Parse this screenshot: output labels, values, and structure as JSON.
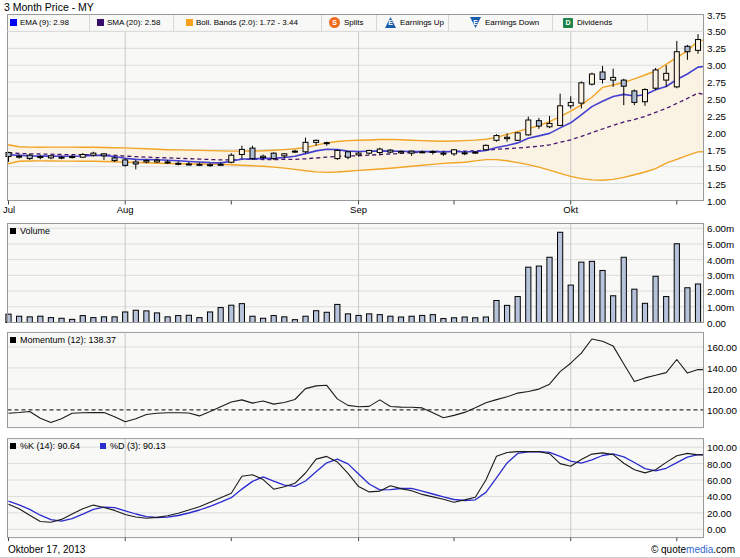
{
  "title": "3 Month Price - MY",
  "price_legend": {
    "ema": {
      "label": "EMA (9): 2.98",
      "swatch": "#0202f0"
    },
    "sma": {
      "label": "SMA (20): 2.58",
      "swatch": "#3a0d68"
    },
    "boll": {
      "label": "Boll. Bands (2.0): 1.72 - 3.44",
      "swatch": "#f6a21d"
    },
    "splits": {
      "label": "Splits",
      "badge": "S",
      "badge_color": "#f26a1b"
    },
    "earnings_up": {
      "label": "Earnings Up",
      "badge": "E",
      "badge_color": "#1a5dab"
    },
    "earnings_down": {
      "label": "Earnings Down",
      "badge": "E",
      "badge_color": "#1a5dab"
    },
    "dividends": {
      "label": "Dividends",
      "badge": "D",
      "badge_color": "#1d8348"
    }
  },
  "panel_labels": {
    "volume": "Volume",
    "momentum": "Momentum (12): 138.37",
    "k": "%K (14): 90.64",
    "d": "%D (3): 90.13"
  },
  "footer": {
    "date": "Oktober 17, 2013",
    "copyright_prefix": "© quote",
    "copyright_brand": "media",
    "copyright_suffix": ".com"
  },
  "colors": {
    "ema_line": "#4340d2",
    "sma_line": "#48156e",
    "boll_line": "#f2a424",
    "boll_fill": "#faf2e2",
    "candle_down_fill": "#aebcd4",
    "candle_stroke": "#000000",
    "volume_fill": "#b7c3da",
    "volume_stroke": "#000000",
    "momentum_line": "#1c1c1c",
    "k_line": "#1c1c1c",
    "d_line": "#2b2bd0",
    "grid": "#dcdcdc",
    "month_line": "#c9c9c9",
    "panel_border": "#9a9a9a",
    "panel_bg": "#f8f8f6",
    "brand_blue": "#3366cc"
  },
  "chart_data": [
    {
      "name": "price",
      "type": "candlestick",
      "title": "3 Month Price - MY",
      "ylim": [
        1.0,
        3.75
      ],
      "yticks": [
        "3.75",
        "3.50",
        "3.25",
        "3.00",
        "2.75",
        "2.50",
        "2.25",
        "2.00",
        "1.75",
        "1.50",
        "1.25",
        "1.00"
      ],
      "x_months": [
        {
          "label": "Jul",
          "i": 0
        },
        {
          "label": "Aug",
          "i": 11
        },
        {
          "label": "Sep",
          "i": 33
        },
        {
          "label": "Okt",
          "i": 53
        }
      ],
      "x_midticks": [
        21,
        42,
        63
      ],
      "open": [
        1.71,
        1.655,
        1.67,
        1.65,
        1.63,
        1.64,
        1.65,
        1.64,
        1.67,
        1.69,
        1.63,
        1.6,
        1.57,
        1.57,
        1.57,
        1.57,
        1.55,
        1.54,
        1.535,
        1.53,
        1.535,
        1.565,
        1.68,
        1.775,
        1.635,
        1.7,
        1.66,
        1.73,
        1.72,
        1.86,
        1.855,
        1.62,
        1.72,
        1.675,
        1.7,
        1.71,
        1.745,
        1.705,
        1.73,
        1.72,
        1.725,
        1.7,
        1.69,
        1.7,
        1.705,
        1.75,
        1.89,
        1.915,
        1.89,
        1.97,
        2.18,
        2.09,
        2.11,
        2.4,
        2.44,
        2.72,
        2.9,
        2.78,
        2.78,
        2.62,
        2.46,
        2.66,
        2.78,
        2.68,
        3.28,
        3.22
      ],
      "high": [
        1.72,
        1.68,
        1.69,
        1.67,
        1.67,
        1.66,
        1.67,
        1.7,
        1.72,
        1.7,
        1.65,
        1.62,
        1.6,
        1.61,
        1.62,
        1.6,
        1.58,
        1.57,
        1.56,
        1.55,
        1.56,
        1.7,
        1.81,
        1.81,
        1.68,
        1.71,
        1.7,
        1.75,
        1.93,
        1.9,
        1.87,
        1.75,
        1.73,
        1.72,
        1.75,
        1.78,
        1.76,
        1.74,
        1.74,
        1.74,
        1.74,
        1.73,
        1.76,
        1.73,
        1.73,
        1.83,
        1.98,
        1.99,
        2.01,
        2.24,
        2.22,
        2.25,
        2.58,
        2.54,
        2.76,
        2.89,
        2.99,
        2.95,
        2.8,
        2.64,
        2.66,
        2.96,
        3.0,
        3.36,
        3.3,
        3.46
      ],
      "low": [
        1.57,
        1.62,
        1.6,
        1.61,
        1.61,
        1.61,
        1.62,
        1.63,
        1.65,
        1.6,
        1.57,
        1.5,
        1.46,
        1.55,
        1.555,
        1.54,
        1.52,
        1.52,
        1.51,
        1.5,
        1.51,
        1.55,
        1.62,
        1.6,
        1.61,
        1.6,
        1.62,
        1.7,
        1.7,
        1.81,
        1.81,
        1.6,
        1.61,
        1.65,
        1.68,
        1.67,
        1.7,
        1.69,
        1.66,
        1.7,
        1.68,
        1.66,
        1.66,
        1.67,
        1.69,
        1.74,
        1.87,
        1.87,
        1.88,
        1.96,
        2.06,
        2.07,
        2.1,
        2.36,
        2.36,
        2.7,
        2.73,
        2.68,
        2.41,
        2.41,
        2.4,
        2.63,
        2.68,
        2.66,
        3.08,
        3.17
      ],
      "close": [
        1.65,
        1.655,
        1.62,
        1.64,
        1.66,
        1.64,
        1.65,
        1.68,
        1.7,
        1.66,
        1.59,
        1.52,
        1.54,
        1.59,
        1.595,
        1.57,
        1.55,
        1.54,
        1.535,
        1.53,
        1.535,
        1.67,
        1.755,
        1.62,
        1.655,
        1.62,
        1.69,
        1.72,
        1.86,
        1.89,
        1.85,
        1.74,
        1.64,
        1.7,
        1.74,
        1.76,
        1.715,
        1.725,
        1.7,
        1.72,
        1.725,
        1.7,
        1.75,
        1.705,
        1.715,
        1.815,
        1.96,
        1.935,
        2.0,
        2.19,
        2.1,
        2.14,
        2.4,
        2.45,
        2.74,
        2.87,
        2.79,
        2.82,
        2.69,
        2.45,
        2.64,
        2.93,
        2.88,
        3.2,
        3.2,
        3.38
      ],
      "series": [
        {
          "name": "EMA (9)",
          "values": [
            1.674,
            1.67,
            1.66,
            1.656,
            1.657,
            1.654,
            1.653,
            1.658,
            1.667,
            1.665,
            1.65,
            1.624,
            1.607,
            1.604,
            1.602,
            1.596,
            1.587,
            1.577,
            1.569,
            1.561,
            1.556,
            1.579,
            1.614,
            1.615,
            1.623,
            1.622,
            1.636,
            1.653,
            1.694,
            1.733,
            1.757,
            1.753,
            1.731,
            1.725,
            1.728,
            1.734,
            1.73,
            1.729,
            1.723,
            1.723,
            1.723,
            1.719,
            1.725,
            1.721,
            1.72,
            1.739,
            1.783,
            1.813,
            1.851,
            1.919,
            1.955,
            1.992,
            2.074,
            2.149,
            2.267,
            2.388,
            2.468,
            2.538,
            2.569,
            2.545,
            2.564,
            2.637,
            2.686,
            2.789,
            2.871,
            2.973
          ]
        },
        {
          "name": "SMA (20)",
          "values": [
            1.702,
            1.697,
            1.691,
            1.687,
            1.684,
            1.68,
            1.678,
            1.677,
            1.676,
            1.673,
            1.668,
            1.657,
            1.647,
            1.641,
            1.635,
            1.63,
            1.624,
            1.618,
            1.612,
            1.606,
            1.6,
            1.601,
            1.607,
            1.607,
            1.606,
            1.605,
            1.607,
            1.609,
            1.617,
            1.629,
            1.642,
            1.653,
            1.658,
            1.663,
            1.67,
            1.68,
            1.688,
            1.698,
            1.706,
            1.715,
            1.725,
            1.726,
            1.726,
            1.73,
            1.733,
            1.743,
            1.757,
            1.767,
            1.774,
            1.789,
            1.802,
            1.822,
            1.86,
            1.897,
            1.947,
            2.003,
            2.057,
            2.111,
            2.161,
            2.197,
            2.243,
            2.304,
            2.361,
            2.436,
            2.51,
            2.588
          ]
        },
        {
          "name": "Boll. Bands upper",
          "values": [
            1.825,
            1.795,
            1.79,
            1.788,
            1.789,
            1.79,
            1.789,
            1.787,
            1.786,
            1.783,
            1.78,
            1.777,
            1.771,
            1.764,
            1.757,
            1.751,
            1.748,
            1.745,
            1.741,
            1.738,
            1.734,
            1.731,
            1.73,
            1.732,
            1.735,
            1.743,
            1.752,
            1.765,
            1.782,
            1.819,
            1.851,
            1.873,
            1.886,
            1.89,
            1.895,
            1.902,
            1.903,
            1.899,
            1.892,
            1.885,
            1.88,
            1.877,
            1.88,
            1.885,
            1.893,
            1.905,
            1.933,
            1.978,
            2.021,
            2.063,
            2.109,
            2.167,
            2.241,
            2.32,
            2.413,
            2.527,
            2.672,
            2.707,
            2.748,
            2.8,
            2.855,
            2.914,
            3.012,
            3.116,
            3.214,
            3.359
          ]
        },
        {
          "name": "Boll. Bands lower",
          "values": [
            1.544,
            1.579,
            1.584,
            1.585,
            1.584,
            1.583,
            1.582,
            1.58,
            1.579,
            1.576,
            1.572,
            1.567,
            1.562,
            1.557,
            1.551,
            1.547,
            1.544,
            1.54,
            1.539,
            1.537,
            1.536,
            1.528,
            1.521,
            1.513,
            1.505,
            1.494,
            1.479,
            1.46,
            1.439,
            1.423,
            1.415,
            1.421,
            1.433,
            1.445,
            1.454,
            1.465,
            1.478,
            1.493,
            1.507,
            1.521,
            1.534,
            1.549,
            1.559,
            1.567,
            1.586,
            1.605,
            1.604,
            1.587,
            1.56,
            1.531,
            1.494,
            1.448,
            1.4,
            1.357,
            1.324,
            1.304,
            1.3,
            1.312,
            1.342,
            1.382,
            1.422,
            1.472,
            1.553,
            1.609,
            1.669,
            1.718
          ]
        }
      ]
    },
    {
      "name": "volume",
      "type": "bar",
      "ylabel_unit": "m",
      "ylim": [
        0,
        6.3
      ],
      "yticks": [
        "6.00m",
        "5.00m",
        "4.00m",
        "3.00m",
        "2.00m",
        "1.00m",
        "0.00"
      ],
      "values": [
        0.53,
        0.4,
        0.36,
        0.4,
        0.31,
        0.27,
        0.2,
        0.44,
        0.31,
        0.36,
        0.36,
        0.67,
        0.78,
        0.74,
        0.61,
        0.36,
        0.44,
        0.46,
        0.31,
        0.67,
        0.95,
        1.1,
        1.2,
        0.4,
        0.27,
        0.44,
        0.36,
        0.18,
        0.4,
        0.75,
        0.65,
        1.15,
        0.55,
        0.45,
        0.55,
        0.5,
        0.4,
        0.35,
        0.4,
        0.45,
        0.5,
        0.25,
        0.3,
        0.35,
        0.3,
        0.35,
        1.4,
        1.09,
        1.65,
        3.52,
        3.59,
        4.15,
        5.74,
        2.38,
        3.84,
        3.89,
        3.31,
        1.7,
        4.15,
        2.12,
        1.22,
        2.94,
        1.65,
        5.01,
        2.21,
        2.45
      ]
    },
    {
      "name": "momentum",
      "type": "line",
      "ylim": [
        82,
        175
      ],
      "yticks": [
        "160.00",
        "140.00",
        "120.00",
        "100.00"
      ],
      "baseline": 100,
      "values": [
        96.9,
        97.5,
        98.5,
        92.0,
        88.1,
        91.5,
        96.9,
        97.2,
        97.4,
        97.4,
        93.5,
        88.8,
        91.5,
        95.6,
        96.8,
        97.2,
        97.2,
        97.0,
        94.3,
        98.5,
        103.0,
        107.5,
        109.5,
        106.5,
        108.5,
        105.5,
        107.0,
        109.9,
        120.3,
        122.9,
        123.4,
        110.5,
        104.3,
        103.0,
        103.3,
        109.5,
        103.2,
        102.7,
        102.6,
        101.9,
        97.2,
        92.5,
        94.8,
        97.6,
        102.0,
        106.8,
        109.8,
        112.5,
        116.0,
        117.5,
        119.8,
        124.5,
        136.5,
        144.5,
        154.0,
        167.5,
        165.3,
        160.8,
        143.7,
        127.0,
        130.5,
        133.0,
        135.5,
        148.0,
        135.0,
        138.4
      ]
    },
    {
      "name": "stochastic",
      "type": "line",
      "ylim": [
        -10,
        110
      ],
      "yticks": [
        "100.00",
        "80.00",
        "60.00",
        "40.00",
        "20.00",
        "0.00"
      ],
      "series": [
        {
          "name": "%K (14)",
          "values": [
            30.5,
            25.0,
            17.0,
            9.5,
            8.5,
            12.0,
            18.5,
            25.0,
            29.5,
            26.6,
            23.0,
            18.0,
            15.0,
            13.5,
            14.5,
            16.5,
            19.5,
            23.5,
            27.5,
            33.0,
            38.5,
            44.0,
            64.5,
            66.5,
            60.5,
            48.8,
            51.8,
            56.0,
            68.5,
            85.5,
            88.8,
            82.0,
            68.0,
            52.0,
            45.5,
            46.5,
            53.0,
            49.5,
            47.0,
            42.5,
            39.5,
            36.5,
            33.0,
            35.8,
            39.0,
            60.0,
            89.0,
            93.5,
            94.6,
            94.6,
            94.6,
            92.0,
            80.0,
            76.8,
            85.0,
            91.5,
            93.0,
            91.0,
            80.5,
            72.5,
            68.7,
            72.5,
            81.5,
            89.5,
            92.4,
            90.6
          ]
        },
        {
          "name": "%D (3)",
          "values": [
            34.17,
            29.83,
            24.17,
            17.17,
            11.67,
            10.0,
            13.0,
            18.5,
            24.33,
            27.03,
            26.37,
            22.53,
            18.67,
            15.5,
            14.33,
            14.83,
            16.83,
            19.83,
            23.5,
            28.0,
            33.0,
            38.5,
            49.0,
            58.33,
            63.83,
            58.6,
            53.7,
            52.2,
            58.77,
            70.0,
            80.93,
            85.43,
            79.6,
            67.33,
            55.17,
            48.0,
            48.33,
            49.67,
            49.83,
            46.33,
            43.0,
            39.5,
            36.33,
            35.1,
            35.93,
            44.93,
            62.67,
            80.83,
            92.37,
            94.23,
            94.6,
            93.73,
            88.87,
            82.93,
            80.6,
            84.43,
            89.83,
            91.83,
            88.17,
            81.33,
            73.9,
            71.23,
            74.23,
            81.17,
            87.8,
            90.83
          ]
        }
      ]
    }
  ]
}
